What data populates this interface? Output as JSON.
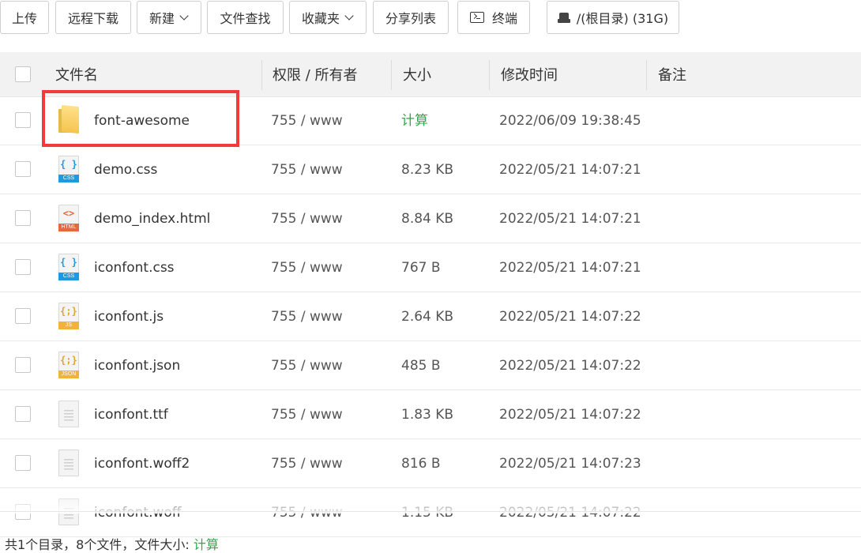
{
  "toolbar": {
    "upload": "上传",
    "remote_download": "远程下载",
    "new": "新建",
    "find": "文件查找",
    "favorites": "收藏夹",
    "share_list": "分享列表",
    "terminal": "终端",
    "disk": "/(根目录) (31G)"
  },
  "table": {
    "headers": {
      "name": "文件名",
      "perm": "权限 / 所有者",
      "size": "大小",
      "mtime": "修改时间",
      "note": "备注"
    },
    "rows": [
      {
        "name": "font-awesome",
        "perm": "755 / www",
        "size": "计算",
        "mtime": "2022/06/09 19:38:45",
        "icon": "folder-icon"
      },
      {
        "name": "demo.css",
        "perm": "755 / www",
        "size": "8.23 KB",
        "mtime": "2022/05/21 14:07:21",
        "icon": "css-file-icon",
        "tag": "CSS"
      },
      {
        "name": "demo_index.html",
        "perm": "755 / www",
        "size": "8.84 KB",
        "mtime": "2022/05/21 14:07:21",
        "icon": "html-file-icon",
        "tag": "HTML"
      },
      {
        "name": "iconfont.css",
        "perm": "755 / www",
        "size": "767 B",
        "mtime": "2022/05/21 14:07:21",
        "icon": "css-file-icon",
        "tag": "CSS"
      },
      {
        "name": "iconfont.js",
        "perm": "755 / www",
        "size": "2.64 KB",
        "mtime": "2022/05/21 14:07:22",
        "icon": "js-file-icon",
        "tag": "JS"
      },
      {
        "name": "iconfont.json",
        "perm": "755 / www",
        "size": "485 B",
        "mtime": "2022/05/21 14:07:22",
        "icon": "json-file-icon",
        "tag": "JSON"
      },
      {
        "name": "iconfont.ttf",
        "perm": "755 / www",
        "size": "1.83 KB",
        "mtime": "2022/05/21 14:07:22",
        "icon": "generic-file-icon"
      },
      {
        "name": "iconfont.woff2",
        "perm": "755 / www",
        "size": "816 B",
        "mtime": "2022/05/21 14:07:23",
        "icon": "generic-file-icon"
      },
      {
        "name": "iconfont.woff",
        "perm": "755 / www",
        "size": "1.15 KB",
        "mtime": "2022/05/21 14:07:22",
        "icon": "generic-file-icon"
      }
    ]
  },
  "footer": {
    "summary": "共1个目录，8个文件，文件大小:",
    "calc_link": "计算"
  },
  "colors": {
    "accent_green": "#2eaa4a",
    "highlight_red": "#f23a3a"
  }
}
